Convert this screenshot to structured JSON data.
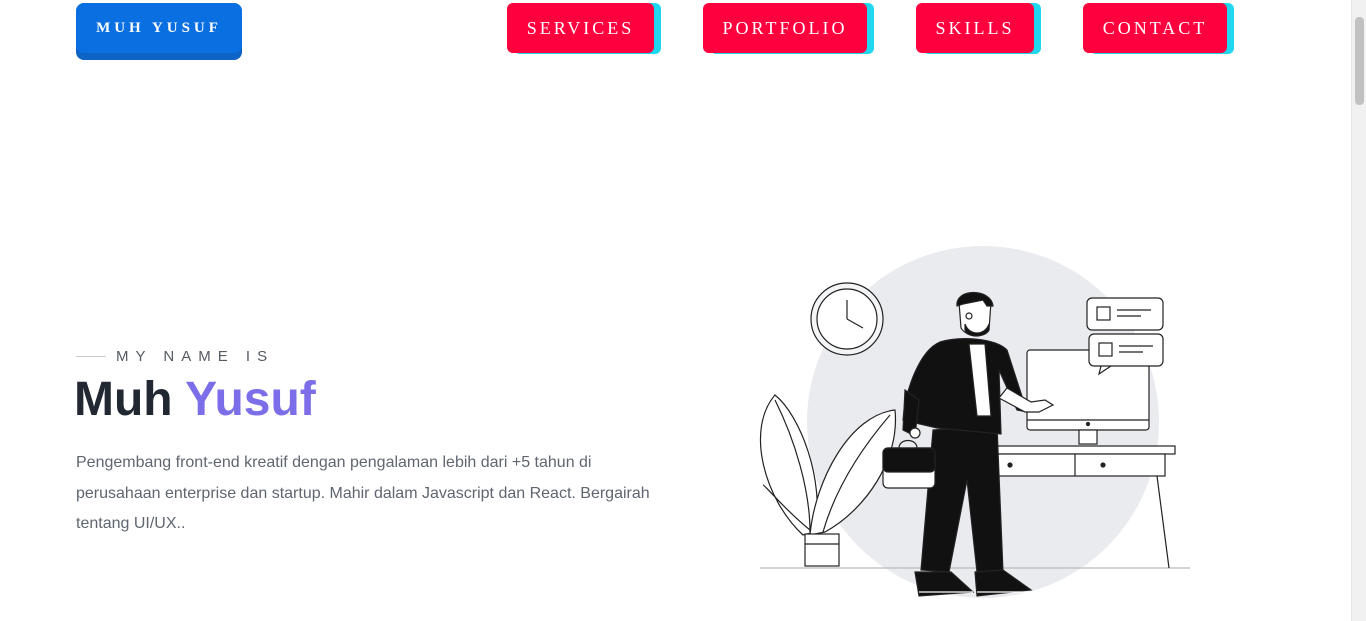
{
  "header": {
    "brand_label": "MUH YUSUF",
    "nav": [
      {
        "label": "SERVICES"
      },
      {
        "label": "PORTFOLIO"
      },
      {
        "label": "SKILLS"
      },
      {
        "label": "CONTACT"
      }
    ]
  },
  "hero": {
    "eyebrow": "MY NAME IS",
    "first_name": "Muh",
    "last_name": "Yusuf",
    "bio": "Pengembang front-end kreatif dengan pengalaman lebih dari +5 tahun di perusahaan enterprise dan startup. Mahir dalam Javascript dan React. Bergairah tentang UI/UX.."
  },
  "colors": {
    "brand_button": "#0a6fe0",
    "nav_button": "#ff003f",
    "nav_shadow": "#1fd8ef",
    "name_accent": "#7b6ee8"
  },
  "icons": {
    "illustration": "developer-at-desk-illustration"
  }
}
